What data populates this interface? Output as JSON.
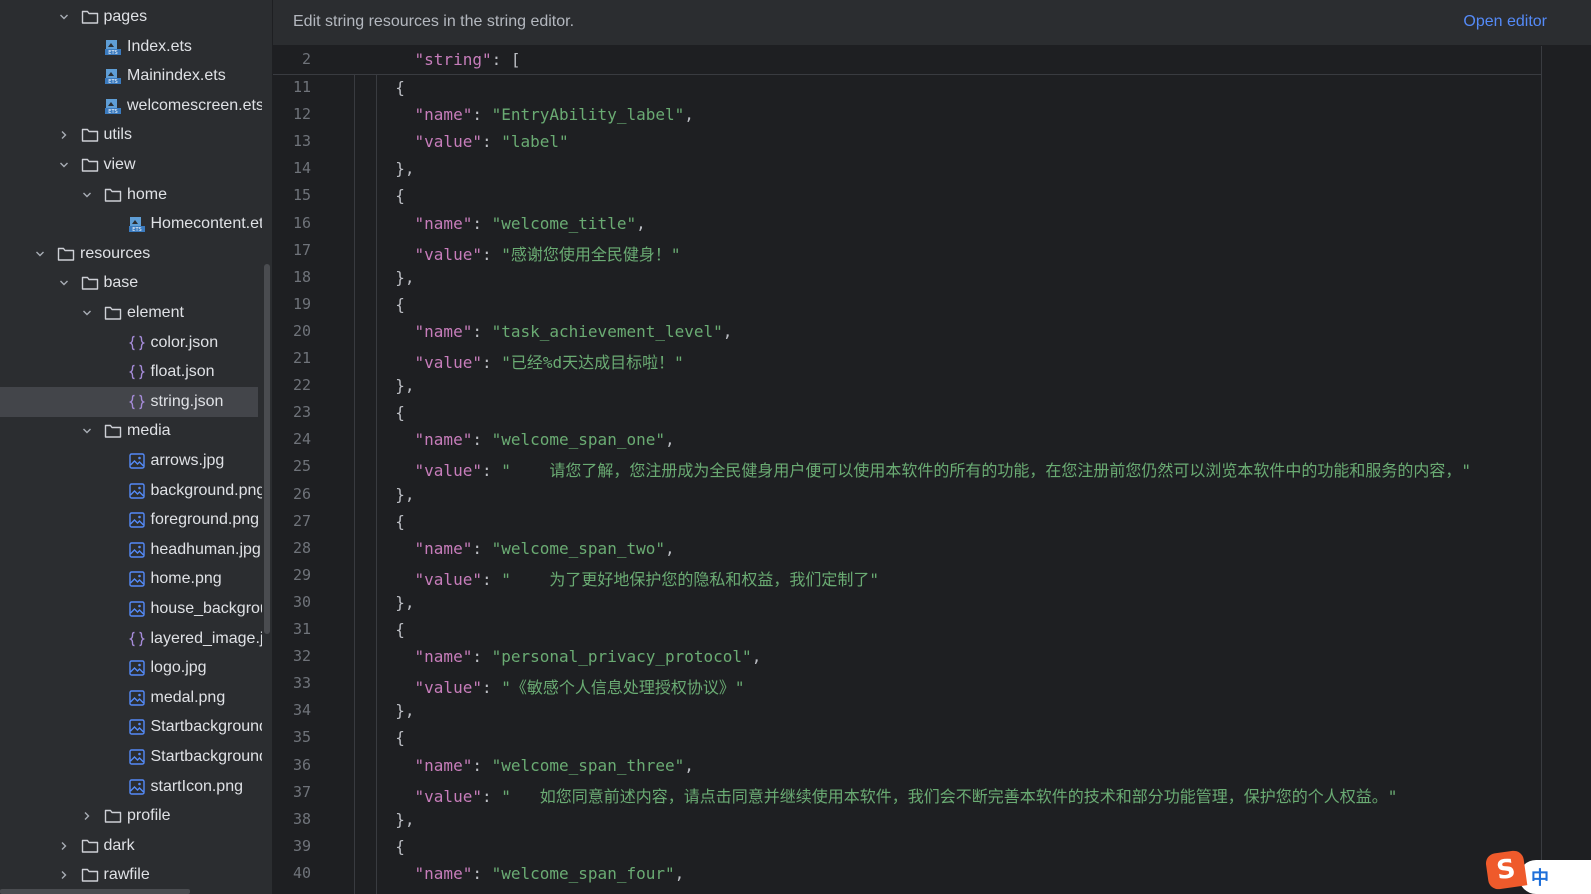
{
  "sidebar": {
    "items": [
      {
        "label": "pages",
        "type": "folder",
        "expanded": true,
        "depth": 2
      },
      {
        "label": "Index.ets",
        "type": "ets",
        "depth": 3
      },
      {
        "label": "Mainindex.ets",
        "type": "ets",
        "depth": 3
      },
      {
        "label": "welcomescreen.ets",
        "type": "ets",
        "depth": 3
      },
      {
        "label": "utils",
        "type": "folder",
        "expanded": false,
        "depth": 2
      },
      {
        "label": "view",
        "type": "folder",
        "expanded": true,
        "depth": 2
      },
      {
        "label": "home",
        "type": "folder",
        "expanded": true,
        "depth": 3
      },
      {
        "label": "Homecontent.ets",
        "type": "ets",
        "depth": 4
      },
      {
        "label": "resources",
        "type": "folder",
        "expanded": true,
        "depth": 1
      },
      {
        "label": "base",
        "type": "folder",
        "expanded": true,
        "depth": 2
      },
      {
        "label": "element",
        "type": "folder",
        "expanded": true,
        "depth": 3
      },
      {
        "label": "color.json",
        "type": "json",
        "depth": 4
      },
      {
        "label": "float.json",
        "type": "json",
        "depth": 4
      },
      {
        "label": "string.json",
        "type": "json",
        "depth": 4,
        "selected": true
      },
      {
        "label": "media",
        "type": "folder",
        "expanded": true,
        "depth": 3
      },
      {
        "label": "arrows.jpg",
        "type": "image",
        "depth": 4
      },
      {
        "label": "background.png",
        "type": "image",
        "depth": 4
      },
      {
        "label": "foreground.png",
        "type": "image",
        "depth": 4
      },
      {
        "label": "headhuman.jpg",
        "type": "image",
        "depth": 4
      },
      {
        "label": "home.png",
        "type": "image",
        "depth": 4
      },
      {
        "label": "house_backgroun",
        "type": "image",
        "depth": 4
      },
      {
        "label": "layered_image.js",
        "type": "json",
        "depth": 4
      },
      {
        "label": "logo.jpg",
        "type": "image",
        "depth": 4
      },
      {
        "label": "medal.png",
        "type": "image",
        "depth": 4
      },
      {
        "label": "Startbackground",
        "type": "image",
        "depth": 4
      },
      {
        "label": "Startbackground",
        "type": "image",
        "depth": 4
      },
      {
        "label": "startIcon.png",
        "type": "image",
        "depth": 4
      },
      {
        "label": "profile",
        "type": "folder",
        "expanded": false,
        "depth": 3
      },
      {
        "label": "dark",
        "type": "folder",
        "expanded": false,
        "depth": 2
      },
      {
        "label": "rawfile",
        "type": "folder",
        "expanded": false,
        "depth": 2
      }
    ]
  },
  "banner": {
    "text": "Edit string resources in the string editor.",
    "action": "Open editor"
  },
  "editor": {
    "sticky": {
      "num": "2",
      "tokens": [
        [
          "k",
          "    \"string\""
        ],
        [
          "p",
          ": ["
        ]
      ]
    },
    "lines": [
      {
        "num": "11",
        "tokens": [
          [
            "p",
            "  {"
          ]
        ]
      },
      {
        "num": "12",
        "tokens": [
          [
            "k",
            "    \"name\""
          ],
          [
            "p",
            ": "
          ],
          [
            "s",
            "\"EntryAbility_label\""
          ],
          [
            "p",
            ","
          ]
        ]
      },
      {
        "num": "13",
        "tokens": [
          [
            "k",
            "    \"value\""
          ],
          [
            "p",
            ": "
          ],
          [
            "s",
            "\"label\""
          ]
        ]
      },
      {
        "num": "14",
        "tokens": [
          [
            "p",
            "  },"
          ]
        ]
      },
      {
        "num": "15",
        "tokens": [
          [
            "p",
            "  {"
          ]
        ]
      },
      {
        "num": "16",
        "tokens": [
          [
            "k",
            "    \"name\""
          ],
          [
            "p",
            ": "
          ],
          [
            "s",
            "\"welcome_title\""
          ],
          [
            "p",
            ","
          ]
        ]
      },
      {
        "num": "17",
        "tokens": [
          [
            "k",
            "    \"value\""
          ],
          [
            "p",
            ": "
          ],
          [
            "s",
            "\"感谢您使用全民健身！\""
          ]
        ]
      },
      {
        "num": "18",
        "tokens": [
          [
            "p",
            "  },"
          ]
        ]
      },
      {
        "num": "19",
        "tokens": [
          [
            "p",
            "  {"
          ]
        ]
      },
      {
        "num": "20",
        "tokens": [
          [
            "k",
            "    \"name\""
          ],
          [
            "p",
            ": "
          ],
          [
            "s",
            "\"task_achievement_level\""
          ],
          [
            "p",
            ","
          ]
        ]
      },
      {
        "num": "21",
        "tokens": [
          [
            "k",
            "    \"value\""
          ],
          [
            "p",
            ": "
          ],
          [
            "s",
            "\"已经%d天达成目标啦！\""
          ]
        ]
      },
      {
        "num": "22",
        "tokens": [
          [
            "p",
            "  },"
          ]
        ]
      },
      {
        "num": "23",
        "tokens": [
          [
            "p",
            "  {"
          ]
        ]
      },
      {
        "num": "24",
        "tokens": [
          [
            "k",
            "    \"name\""
          ],
          [
            "p",
            ": "
          ],
          [
            "s",
            "\"welcome_span_one\""
          ],
          [
            "p",
            ","
          ]
        ]
      },
      {
        "num": "25",
        "tokens": [
          [
            "k",
            "    \"value\""
          ],
          [
            "p",
            ": "
          ],
          [
            "s",
            "\"    请您了解，您注册成为全民健身用户便可以使用本软件的所有的功能，在您注册前您仍然可以浏览本软件中的功能和服务的内容，\""
          ]
        ]
      },
      {
        "num": "26",
        "tokens": [
          [
            "p",
            "  },"
          ]
        ]
      },
      {
        "num": "27",
        "tokens": [
          [
            "p",
            "  {"
          ]
        ]
      },
      {
        "num": "28",
        "tokens": [
          [
            "k",
            "    \"name\""
          ],
          [
            "p",
            ": "
          ],
          [
            "s",
            "\"welcome_span_two\""
          ],
          [
            "p",
            ","
          ]
        ]
      },
      {
        "num": "29",
        "tokens": [
          [
            "k",
            "    \"value\""
          ],
          [
            "p",
            ": "
          ],
          [
            "s",
            "\"    为了更好地保护您的隐私和权益，我们定制了\""
          ]
        ]
      },
      {
        "num": "30",
        "tokens": [
          [
            "p",
            "  },"
          ]
        ]
      },
      {
        "num": "31",
        "tokens": [
          [
            "p",
            "  {"
          ]
        ]
      },
      {
        "num": "32",
        "tokens": [
          [
            "k",
            "    \"name\""
          ],
          [
            "p",
            ": "
          ],
          [
            "s",
            "\"personal_privacy_protocol\""
          ],
          [
            "p",
            ","
          ]
        ]
      },
      {
        "num": "33",
        "tokens": [
          [
            "k",
            "    \"value\""
          ],
          [
            "p",
            ": "
          ],
          [
            "s",
            "\"《敏感个人信息处理授权协议》\""
          ]
        ]
      },
      {
        "num": "34",
        "tokens": [
          [
            "p",
            "  },"
          ]
        ]
      },
      {
        "num": "35",
        "tokens": [
          [
            "p",
            "  {"
          ]
        ]
      },
      {
        "num": "36",
        "tokens": [
          [
            "k",
            "    \"name\""
          ],
          [
            "p",
            ": "
          ],
          [
            "s",
            "\"welcome_span_three\""
          ],
          [
            "p",
            ","
          ]
        ]
      },
      {
        "num": "37",
        "tokens": [
          [
            "k",
            "    \"value\""
          ],
          [
            "p",
            ": "
          ],
          [
            "s",
            "\"   如您同意前述内容，请点击同意并继续使用本软件，我们会不断完善本软件的技术和部分功能管理，保护您的个人权益。\""
          ]
        ]
      },
      {
        "num": "38",
        "tokens": [
          [
            "p",
            "  },"
          ]
        ]
      },
      {
        "num": "39",
        "tokens": [
          [
            "p",
            "  {"
          ]
        ]
      },
      {
        "num": "40",
        "tokens": [
          [
            "k",
            "    \"name\""
          ],
          [
            "p",
            ": "
          ],
          [
            "s",
            "\"welcome_span_four\""
          ],
          [
            "p",
            ","
          ]
        ]
      }
    ]
  },
  "ime": {
    "logo": "S",
    "mode": "中"
  },
  "colors": {
    "keyword": "#c77dbb",
    "string": "#6aab73",
    "link": "#548af7",
    "selected": "#43454a"
  },
  "icons": {
    "folder": "folder-icon",
    "ets": "ets-file-icon",
    "json": "json-braces-icon",
    "image": "image-file-icon",
    "chevron_open": "chevron-down-icon",
    "chevron_closed": "chevron-right-icon"
  }
}
